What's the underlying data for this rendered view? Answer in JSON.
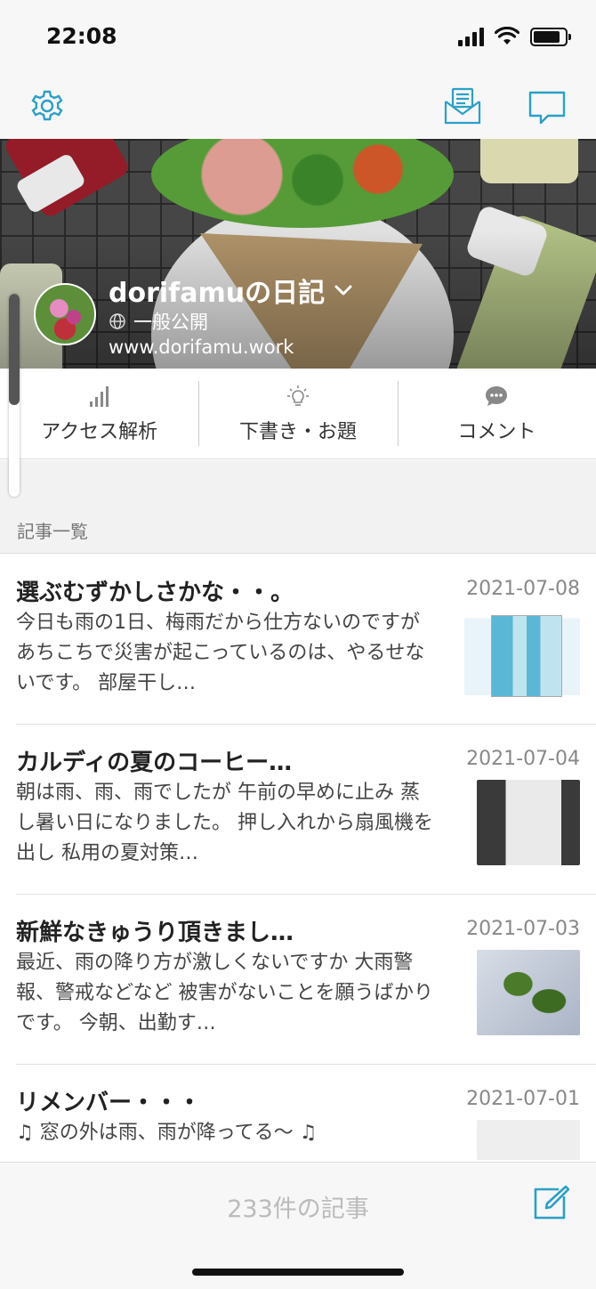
{
  "status_bar": {
    "time": "22:08",
    "signal_icon": "signal-icon",
    "wifi_icon": "wifi-icon",
    "battery_icon": "battery-icon",
    "battery_level": 0.85
  },
  "nav": {
    "settings_icon": "gear-icon",
    "inbox_icon": "inbox-mail-icon",
    "message_icon": "chat-bubble-icon",
    "accent_color": "#2aa0c8"
  },
  "blog": {
    "title": "dorifamuの日記",
    "visibility": "一般公開",
    "url": "www.dorifamu.work"
  },
  "actions": [
    {
      "label": "アクセス解析",
      "icon": "bar-chart-icon"
    },
    {
      "label": "下書き・お題",
      "icon": "lightbulb-icon"
    },
    {
      "label": "コメント",
      "icon": "comment-icon"
    }
  ],
  "scroll_position": 0.55,
  "section": {
    "title": "記事一覧"
  },
  "entries": [
    {
      "title": "選ぶむずかしさかな・・。",
      "date": "2021-07-08",
      "excerpt": "今日も雨の1日、梅雨だから仕方ないのですが あちこちで災害が起こっているのは、やるせないです。 部屋干し…"
    },
    {
      "title": "カルディの夏のコーヒー…",
      "date": "2021-07-04",
      "excerpt": "朝は雨、雨、雨でしたが 午前の早めに止み 蒸し暑い日になりました。 押し入れから扇風機を出し 私用の夏対策…"
    },
    {
      "title": "新鮮なきゅうり頂きまし…",
      "date": "2021-07-03",
      "excerpt": "最近、雨の降り方が激しくないですか 大雨警報、警戒などなど 被害がないことを願うばかりです。 今朝、出勤す…"
    },
    {
      "title": "リメンバー・・・",
      "date": "2021-07-01",
      "excerpt": "♫ 窓の外は雨、雨が降ってる〜 ♫"
    }
  ],
  "footer": {
    "entry_count": "233件の記事",
    "compose_icon": "compose-icon"
  }
}
